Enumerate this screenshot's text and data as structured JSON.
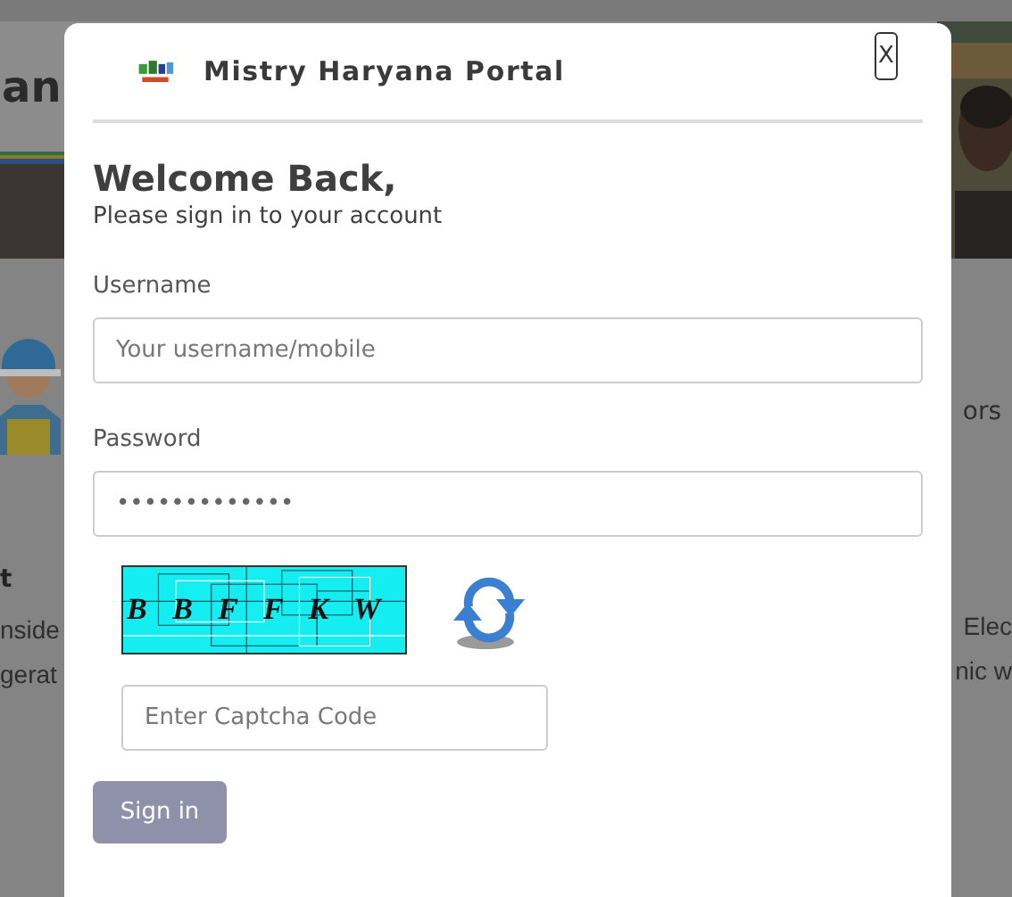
{
  "background": {
    "heading": "an",
    "right_label": "ors",
    "section_title": "t",
    "lines_left": [
      "nside",
      "gerat"
    ],
    "lines_right": [
      "Elec",
      "nic w"
    ]
  },
  "modal": {
    "title": "Mistry Haryana Portal",
    "close": "X",
    "heading": "Welcome Back,",
    "subtitle": "Please sign in to your account",
    "fields": [
      {
        "label": "Username",
        "placeholder": "Your username/mobile"
      },
      {
        "label": "Password",
        "value": "•••••••••••••"
      }
    ],
    "captcha": {
      "code": "B B F F K W",
      "placeholder": "Enter Captcha Code"
    },
    "submit": {
      "label": "Sign in",
      "disabled": true
    }
  }
}
